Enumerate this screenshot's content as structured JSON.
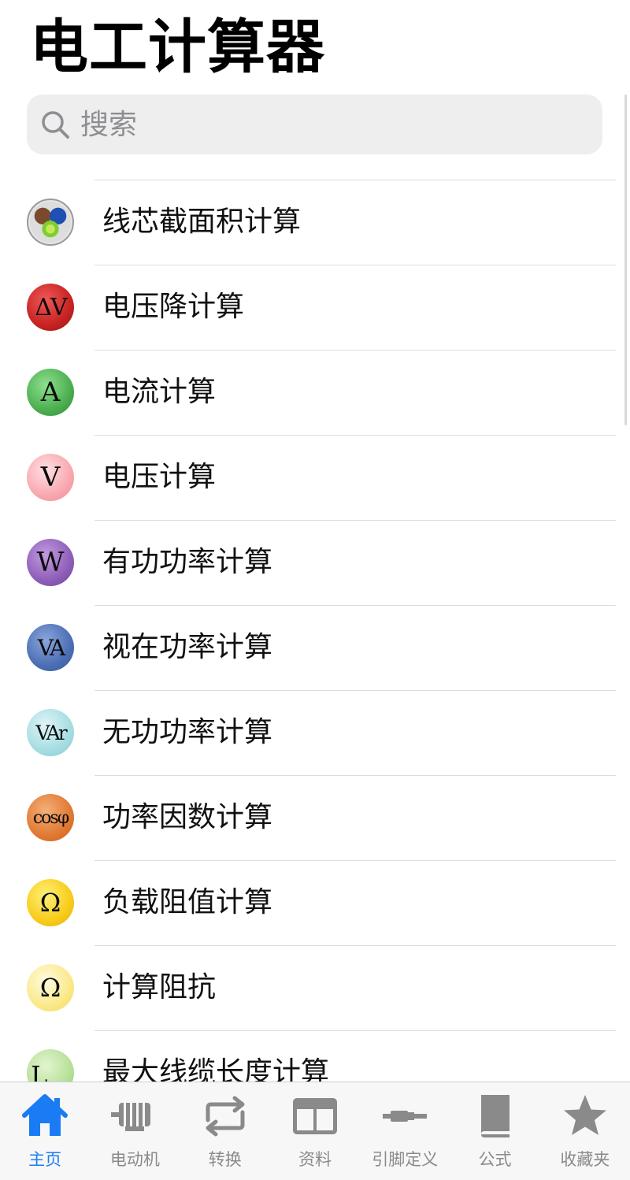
{
  "header": {
    "title": "电工计算器"
  },
  "search": {
    "placeholder": "搜索"
  },
  "list": {
    "items": [
      {
        "label": "线芯截面积计算",
        "icon": "wire-cross-section-icon"
      },
      {
        "label": "电压降计算",
        "icon": "voltage-drop-icon",
        "icon_text": "ΔV"
      },
      {
        "label": "电流计算",
        "icon": "current-icon",
        "icon_text": "A"
      },
      {
        "label": "电压计算",
        "icon": "voltage-icon",
        "icon_text": "V"
      },
      {
        "label": "有功功率计算",
        "icon": "active-power-icon",
        "icon_text": "W"
      },
      {
        "label": "视在功率计算",
        "icon": "apparent-power-icon",
        "icon_text": "VA"
      },
      {
        "label": "无功功率计算",
        "icon": "reactive-power-icon",
        "icon_text": "VAr"
      },
      {
        "label": "功率因数计算",
        "icon": "power-factor-icon",
        "icon_text": "cosφ"
      },
      {
        "label": "负载阻值计算",
        "icon": "load-resistance-icon",
        "icon_text": "Ω"
      },
      {
        "label": "计算阻抗",
        "icon": "impedance-icon",
        "icon_text": "Ω"
      },
      {
        "label": "最大线缆长度计算",
        "icon": "max-cable-length-icon",
        "icon_text": "L",
        "icon_subtext": "max"
      }
    ]
  },
  "tabbar": {
    "tabs": [
      {
        "label": "主页",
        "icon": "home-icon",
        "active": true
      },
      {
        "label": "电动机",
        "icon": "motor-icon"
      },
      {
        "label": "转换",
        "icon": "convert-icon"
      },
      {
        "label": "资料",
        "icon": "reference-icon"
      },
      {
        "label": "引脚定义",
        "icon": "pinout-icon"
      },
      {
        "label": "公式",
        "icon": "formula-book-icon"
      },
      {
        "label": "收藏夹",
        "icon": "favorites-star-icon"
      }
    ]
  },
  "colors": {
    "accent": "#1a7cf5",
    "inactive": "#8a8a8a",
    "search_bg": "#eeeeef"
  }
}
